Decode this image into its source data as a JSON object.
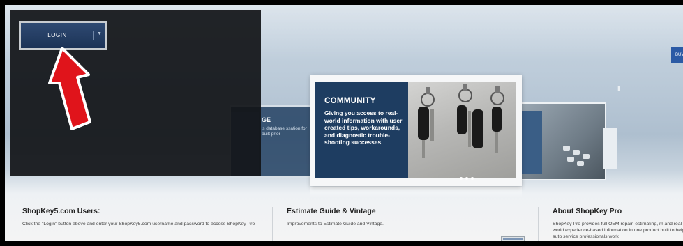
{
  "toolbar": {
    "login_label": "LOGIN",
    "buy_label": "BUY"
  },
  "carousel": {
    "active": {
      "title": "COMMUNITY",
      "description": "Giving you access to real-world information with user created tips, workarounds, and diagnostic trouble-shooting successes."
    },
    "left_card": {
      "title": "GE",
      "description": "'s database ssation for built prior"
    },
    "pause_label": "II"
  },
  "sections": [
    {
      "title": "ShopKey5.com Users:",
      "body": "Click the \"Login\" button above and enter your ShopKey5.com username and password to access ShopKey Pro"
    },
    {
      "title": "Estimate Guide & Vintage",
      "body": "Improvements to Estimate Guide and Vintage."
    },
    {
      "title": "About ShopKey Pro",
      "body": "ShopKey Pro provides full OEM repair, estimating, m and real-world experience-based information in one product built to help auto service professionals work"
    }
  ],
  "colors": {
    "brand_navy": "#1e3d61",
    "annotation_arrow": "#e0141b",
    "button_blue": "#2b5aa5"
  }
}
